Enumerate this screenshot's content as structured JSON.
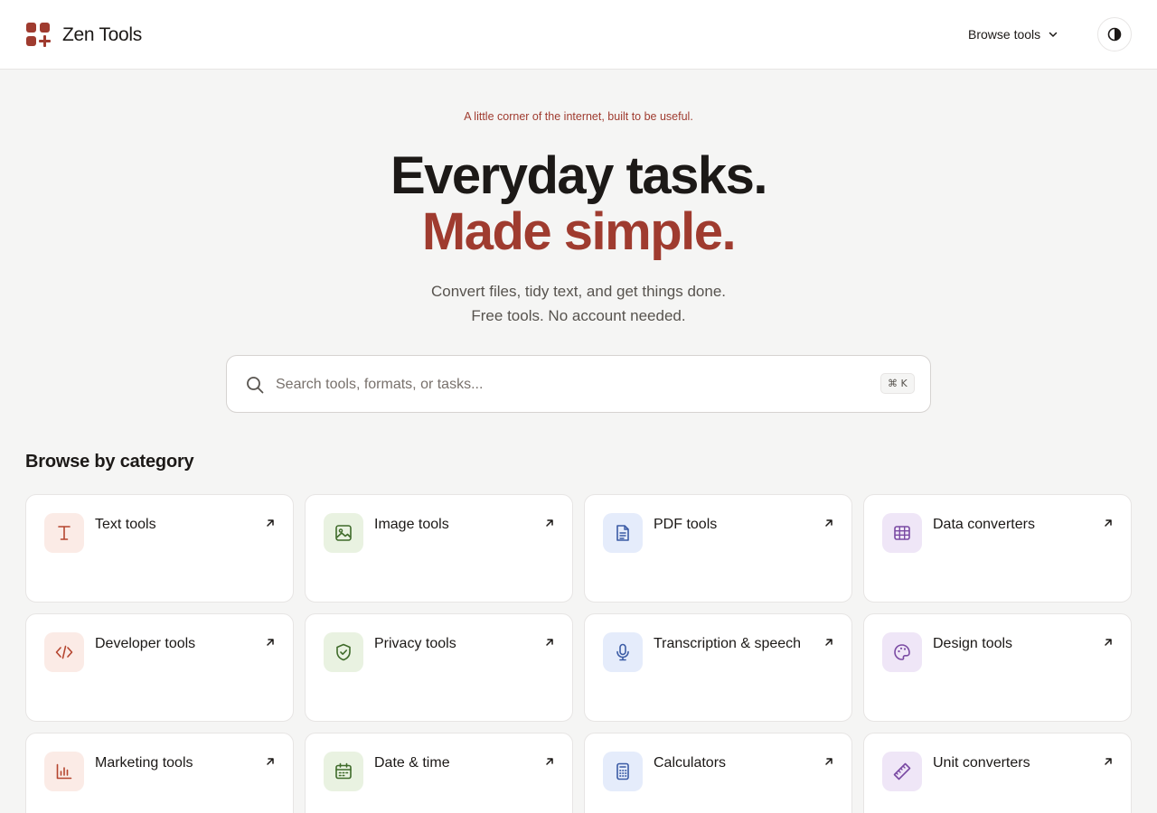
{
  "header": {
    "brand": "Zen Tools",
    "browse_label": "Browse tools",
    "theme_toggle": "contrast-icon"
  },
  "hero": {
    "tagline": "A little corner of the internet, built to be useful.",
    "headline_line1": "Everyday tasks.",
    "headline_line2": "Made simple.",
    "subtitle_line1": "Convert files, tidy text, and get things done.",
    "subtitle_line2": "Free tools. No account needed."
  },
  "search": {
    "placeholder": "Search tools, formats, or tasks...",
    "value": "",
    "shortcut": "⌘ K"
  },
  "categories": {
    "title": "Browse by category",
    "items": [
      {
        "label": "Text tools",
        "icon": "text-cursor-icon",
        "tint": "red"
      },
      {
        "label": "Image tools",
        "icon": "image-icon",
        "tint": "green"
      },
      {
        "label": "PDF tools",
        "icon": "document-icon",
        "tint": "blue"
      },
      {
        "label": "Data converters",
        "icon": "table-icon",
        "tint": "purple"
      },
      {
        "label": "Developer tools",
        "icon": "code-icon",
        "tint": "red"
      },
      {
        "label": "Privacy tools",
        "icon": "shield-check-icon",
        "tint": "green"
      },
      {
        "label": "Transcription & speech",
        "icon": "microphone-icon",
        "tint": "blue"
      },
      {
        "label": "Design tools",
        "icon": "palette-icon",
        "tint": "purple"
      },
      {
        "label": "Marketing tools",
        "icon": "bar-chart-icon",
        "tint": "red"
      },
      {
        "label": "Date & time",
        "icon": "calendar-icon",
        "tint": "green"
      },
      {
        "label": "Calculators",
        "icon": "calculator-icon",
        "tint": "blue"
      },
      {
        "label": "Unit converters",
        "icon": "ruler-icon",
        "tint": "purple"
      }
    ]
  },
  "colors": {
    "accent": "#9f3b2f",
    "background": "#f5f5f4",
    "card": "#ffffff"
  }
}
